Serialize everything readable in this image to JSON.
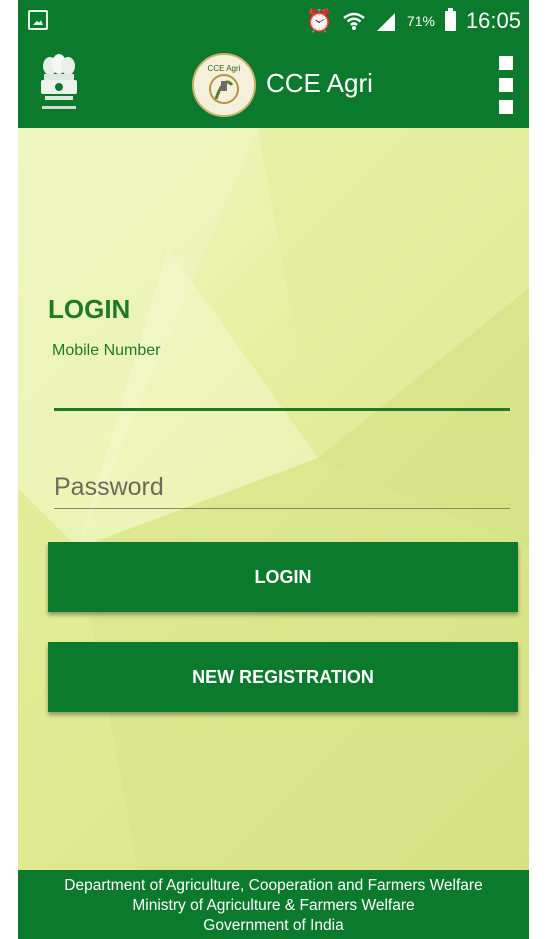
{
  "status_bar": {
    "battery_percent": "71%",
    "time": "16:05",
    "icons": [
      "gallery-icon",
      "alarm-icon",
      "wifi-icon",
      "signal-icon",
      "battery-icon"
    ]
  },
  "app_bar": {
    "title": "CCE Agri",
    "logo_text": "CCE Agri"
  },
  "login": {
    "heading": "LOGIN",
    "mobile_label": "Mobile Number",
    "mobile_value": "",
    "password_placeholder": "Password",
    "password_value": "",
    "login_button": "LOGIN",
    "register_button": "NEW REGISTRATION"
  },
  "footer": {
    "line1": "Department of Agriculture, Cooperation and Farmers Welfare",
    "line2": "Ministry of Agriculture & Farmers Welfare",
    "line3": "Government of India"
  },
  "colors": {
    "primary_green": "#0b7a2c",
    "text_green": "#1f7a27",
    "background": "#e4ee9e"
  }
}
